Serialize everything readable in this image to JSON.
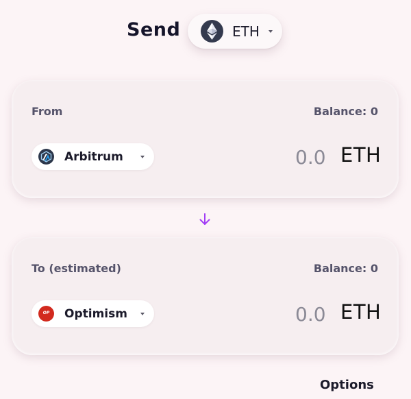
{
  "header": {
    "title": "Send",
    "token": {
      "symbol": "ETH",
      "icon": "ethereum-icon"
    }
  },
  "from_card": {
    "label": "From",
    "balance": "Balance: 0",
    "network": {
      "name": "Arbitrum",
      "icon": "arbitrum-icon"
    },
    "amount": "0.0",
    "unit": "ETH"
  },
  "direction": {
    "icon": "arrow-down-icon",
    "color": "#a23df5"
  },
  "to_card": {
    "label": "To (estimated)",
    "balance": "Balance: 0",
    "network": {
      "name": "Optimism",
      "icon": "optimism-icon",
      "icon_text": "OP"
    },
    "amount": "0.0",
    "unit": "ETH"
  },
  "footer": {
    "options_label": "Options"
  },
  "colors": {
    "background": "#fcf4f6",
    "card": "#f6eef0",
    "accent": "#a23df5",
    "optimism_red": "#d22a1e",
    "arbitrum_navy": "#2c374b",
    "eth_dark": "#343a4e"
  }
}
